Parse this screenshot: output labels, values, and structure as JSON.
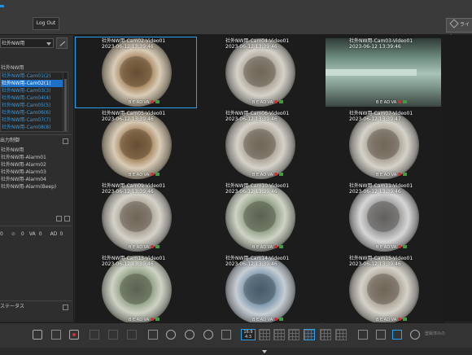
{
  "header": {
    "logout_label": "Log Out",
    "live_label": "ライブ"
  },
  "sidebar": {
    "site_select_value": "社外NW用",
    "tree_root": "社外NW用",
    "cameras": [
      "社外NW用-Cam01(2)",
      "社外NW用-Cam02(1)",
      "社外NW用-Cam03(3)",
      "社外NW用-Cam04(4)",
      "社外NW用-Cam05(5)",
      "社外NW用-Cam06(6)",
      "社外NW用-Cam07(7)",
      "社外NW用-Cam08(8)"
    ],
    "selected_camera_index": 1,
    "output_control_title": "出力制御",
    "alarm_root": "社外NW用",
    "alarms": [
      "社外NW用-Alarm01",
      "社外NW用-Alarm02",
      "社外NW用-Alarm03",
      "社外NW用-Alarm04",
      "社外NW用-Alarm(Beep)"
    ],
    "stats": {
      "a": "0",
      "b": "0",
      "va_label": "VA",
      "va": "0",
      "ad_label": "AD",
      "ad": "0"
    },
    "status_title": "ステータス"
  },
  "grid": {
    "cells": [
      {
        "title": "社外NW用-Cam02-Video01",
        "time": "2023-06-12 13:39:46",
        "style": "warm",
        "selected": true
      },
      {
        "title": "社外NW用-Cam04-Video01",
        "time": "2023-06-12 13:39:46",
        "style": "plain",
        "selected": false
      },
      {
        "title": "社外NW用-Cam03-Video01",
        "time": "2023-06-12 13:39:46",
        "style": "panorama",
        "selected": false
      },
      {
        "title": "社外NW用-Cam05-Video01",
        "time": "2023-06-12 13:39:46",
        "style": "warm",
        "selected": false
      },
      {
        "title": "社外NW用-Cam06-Video01",
        "time": "2023-06-12 13:39:46",
        "style": "plain",
        "selected": false
      },
      {
        "title": "社外NW用-Cam07-Video01",
        "time": "2023-06-12 13:39:47",
        "style": "plain",
        "selected": false
      },
      {
        "title": "社外NW用-Cam09-Video01",
        "time": "2023-06-12 13:39:46",
        "style": "plain",
        "selected": false
      },
      {
        "title": "社外NW用-Cam10-Video01",
        "time": "2023-06-12 13:39:46",
        "style": "green",
        "selected": false
      },
      {
        "title": "社外NW用-Cam11-Video01",
        "time": "2023-06-12 13:39:46",
        "style": "bw",
        "selected": false
      },
      {
        "title": "社外NW用-Cam13-Video01",
        "time": "2023-06-12 13:39:46",
        "style": "green",
        "selected": false
      },
      {
        "title": "社外NW用-Cam14-Video01",
        "time": "2023-06-12 13:39:46",
        "style": "blue",
        "selected": false
      },
      {
        "title": "社外NW用-Cam15-Video01",
        "time": "2023-06-12 13:39:46",
        "style": "plain",
        "selected": false
      }
    ],
    "status_text": "B E AD VA"
  },
  "toolbar": {
    "layout_16_9": "16:9",
    "layout_4_3": "4:3",
    "right_text": "登録済みの"
  },
  "colors": {
    "accent": "#2aa0f0",
    "selected_row": "#1d6fc8",
    "camera_text": "#2a9ff0",
    "background": "#2b2b2b"
  }
}
